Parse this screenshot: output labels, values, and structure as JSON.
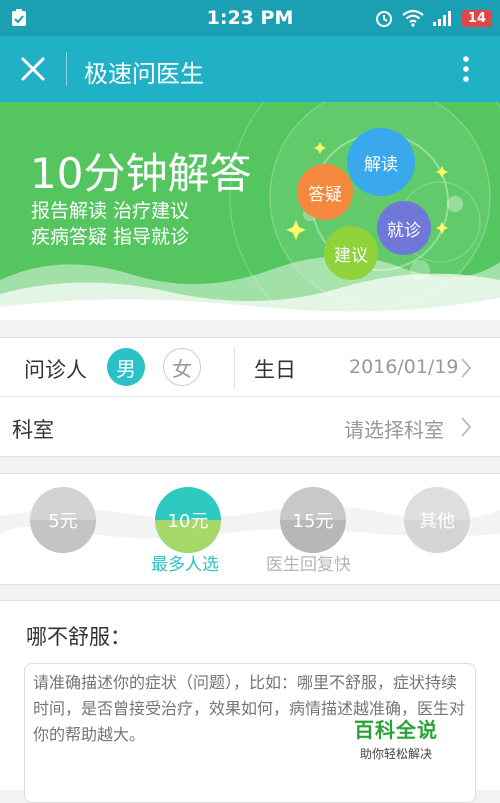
{
  "status_bar": {
    "time": "1:23 PM",
    "battery_level": "14",
    "icons": [
      "app-notification-icon",
      "alarm-icon",
      "wifi-icon",
      "signal-icon",
      "battery-icon"
    ]
  },
  "app_bar": {
    "title": "极速问医生",
    "close_icon": "close-icon",
    "menu_icon": "more-vert-icon"
  },
  "banner": {
    "headline": "10分钟解答",
    "lines": [
      "报告解读  治疗建议",
      "疾病答疑  指导就诊"
    ],
    "bubbles": [
      {
        "label": "解读",
        "color": "#3aa8ec"
      },
      {
        "label": "答疑",
        "color": "#f4883c"
      },
      {
        "label": "就诊",
        "color": "#6f78d8"
      },
      {
        "label": "建议",
        "color": "#8fd23a"
      }
    ]
  },
  "patient": {
    "label": "问诊人",
    "gender_male": "男",
    "gender_female": "女",
    "selected_gender": "男",
    "birthday_label": "生日",
    "birthday_value": "2016/01/19"
  },
  "department": {
    "label": "科室",
    "placeholder": "请选择科室"
  },
  "pricing": {
    "options": [
      {
        "label": "5元",
        "note": ""
      },
      {
        "label": "10元",
        "note": "最多人选"
      },
      {
        "label": "15元",
        "note": "医生回复快"
      },
      {
        "label": "其他",
        "note": ""
      }
    ],
    "selected": "10元",
    "colors": {
      "selected": "#2ec9c1",
      "selected_fill": "#a6d86a",
      "note_selected": "#2bc3c3",
      "note_default": "#b5b5b5"
    }
  },
  "symptom": {
    "title": "哪不舒服：",
    "placeholder": "请准确描述你的症状（问题），比如：哪里不舒服，症状持续时间，是否曾接受治疗，效果如何，病情描述越准确，医生对你的帮助越大。"
  },
  "watermark": {
    "title": "百科全说",
    "subtitle": "助你轻松解决"
  },
  "colors": {
    "status_bar": "#1b9fb3",
    "app_bar": "#21b1c6",
    "banner": "#55c65f",
    "accent": "#2ac2c6"
  }
}
